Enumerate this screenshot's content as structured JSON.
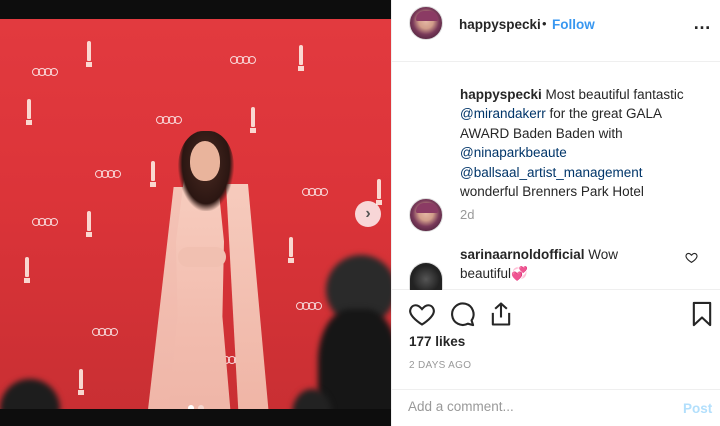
{
  "post": {
    "username": "happyspecki",
    "dot": "•",
    "follow_label": "Follow",
    "more_icon": "…",
    "caption": {
      "username": "happyspecki",
      "text_1": " Most beautiful fantastic ",
      "mention_1": "@mirandakerr",
      "text_2": " for the great GALA AWARD Baden Baden with ",
      "mention_2": "@ninaparkbeaute",
      "mention_3": "@ballsaal_artist_management",
      "text_3": "wonderful Brenners Park Hotel",
      "time": "2d"
    },
    "comment": {
      "username": "sarinaarnoldofficial",
      "text": " Wow beautiful💞",
      "heart_icon": "heart-outline-icon"
    },
    "likes": "177 likes",
    "date": "2 DAYS AGO",
    "add_comment_placeholder": "Add a comment...",
    "post_button": "Post",
    "icons": {
      "like": "heart-icon",
      "comment": "comment-icon",
      "share": "share-icon",
      "save": "bookmark-icon",
      "next": "chevron-right-icon"
    },
    "carousel": {
      "slides": 2,
      "active": 1
    },
    "colors": {
      "follow": "#3897f0",
      "mention": "#003569",
      "post_disabled": "#b2dffc",
      "muted": "#999999"
    }
  }
}
